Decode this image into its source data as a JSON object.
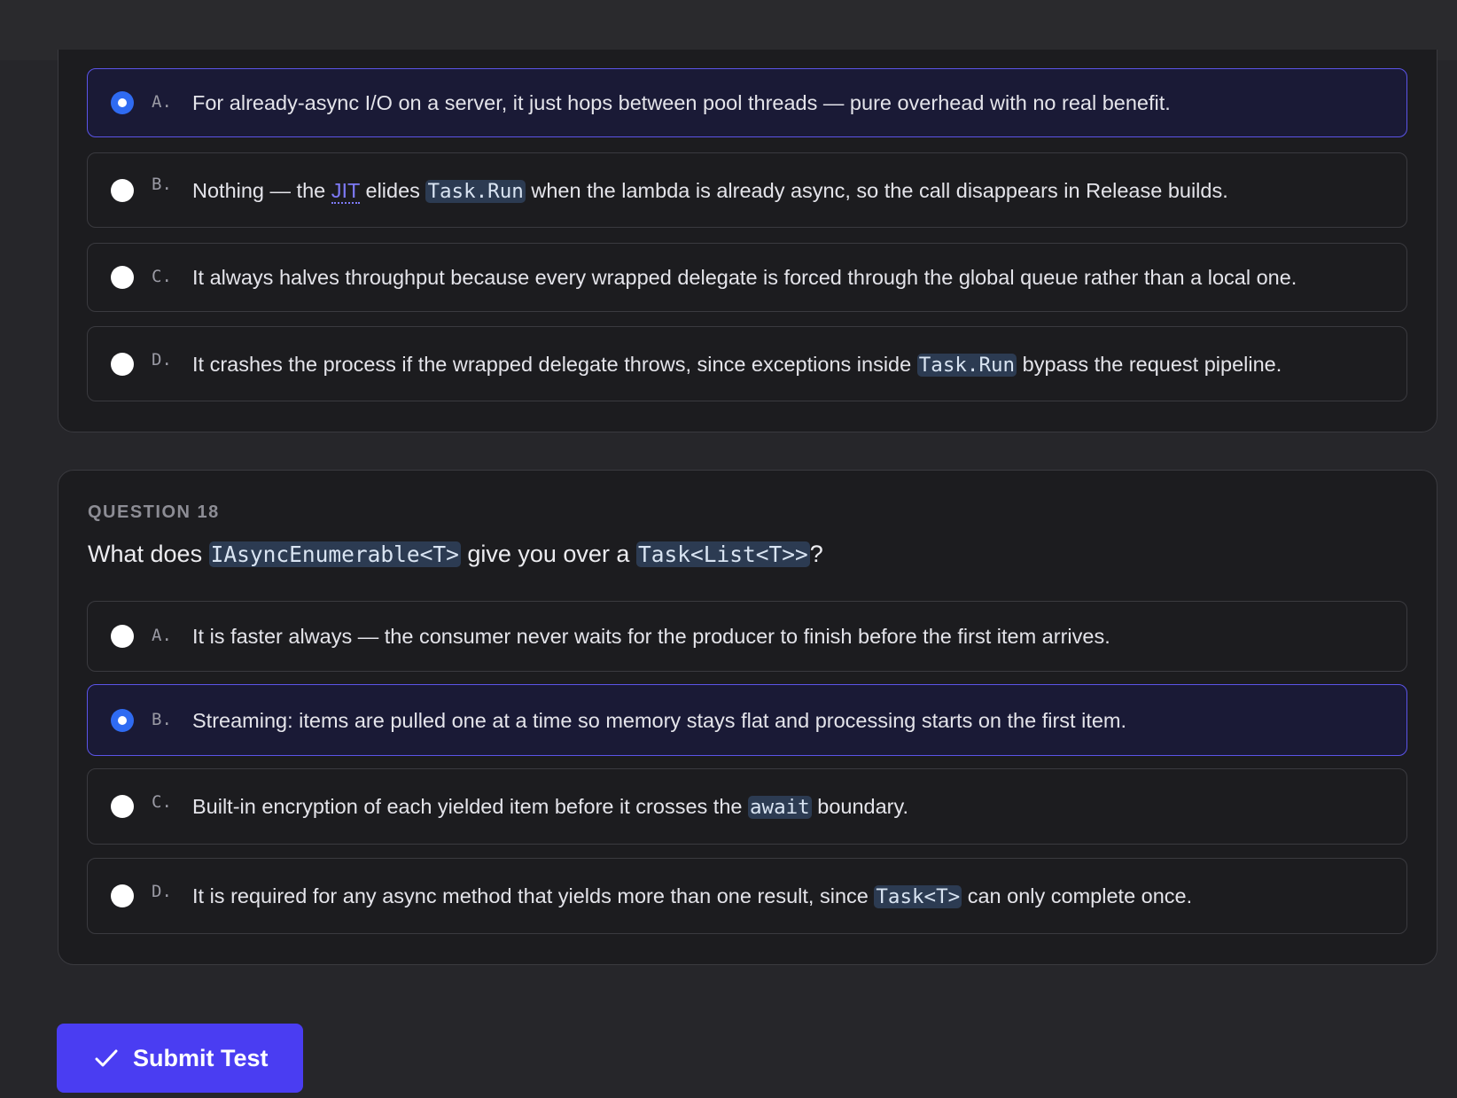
{
  "question17": {
    "options": [
      {
        "letter": "A.",
        "text": "For already-async I/O on a server, it just hops between pool threads — pure overhead with no real benefit.",
        "selected": true
      },
      {
        "letter": "B.",
        "text_1": "Nothing — the ",
        "link": "JIT",
        "text_2": " elides ",
        "code": "Task.Run",
        "text_3": " when the lambda is already async, so the call disappears in Release builds.",
        "selected": false
      },
      {
        "letter": "C.",
        "text": "It always halves throughput because every wrapped delegate is forced through the global queue rather than a local one.",
        "selected": false
      },
      {
        "letter": "D.",
        "text_1": "It crashes the process if the wrapped delegate throws, since exceptions inside ",
        "code": "Task.Run",
        "text_2": " bypass the request pipeline.",
        "selected": false
      }
    ]
  },
  "question18": {
    "label": "QUESTION 18",
    "text_1": "What does ",
    "code_1": "IAsyncEnumerable<T>",
    "text_2": " give you over a ",
    "code_2": "Task<List<T>>",
    "text_3": "?",
    "options": [
      {
        "letter": "A.",
        "text": "It is faster always — the consumer never waits for the producer to finish before the first item arrives.",
        "selected": false
      },
      {
        "letter": "B.",
        "text": "Streaming: items are pulled one at a time so memory stays flat and processing starts on the first item.",
        "selected": true
      },
      {
        "letter": "C.",
        "text_1": "Built-in encryption of each yielded item before it crosses the ",
        "code": "await",
        "text_2": " boundary.",
        "selected": false
      },
      {
        "letter": "D.",
        "text_1": "It is required for any async method that yields more than one result, since ",
        "code": "Task<T>",
        "text_2": " can only complete once.",
        "selected": false
      }
    ]
  },
  "submit": {
    "label": "Submit Test",
    "icon": "check-icon"
  },
  "colors": {
    "accent": "#4a3df2",
    "radio_selected": "#2f6bf2",
    "selected_border": "#5b54e8",
    "selected_bg": "#1a1a36",
    "link": "#7e7af7",
    "code_bg": "#2c3b52"
  }
}
